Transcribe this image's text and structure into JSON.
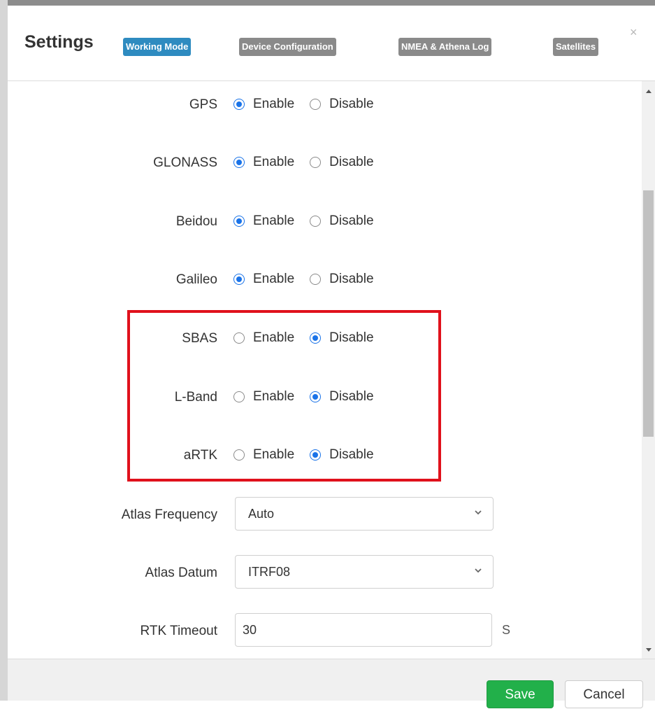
{
  "dialog": {
    "title": "Settings",
    "tabs": [
      {
        "label": "Working Mode",
        "active": true
      },
      {
        "label": "Device Configuration",
        "active": false
      },
      {
        "label": "NMEA & Athena Log",
        "active": false
      },
      {
        "label": "Satellites",
        "active": false
      }
    ],
    "close_glyph": "×"
  },
  "form": {
    "enable_label": "Enable",
    "disable_label": "Disable",
    "constellations": [
      {
        "label": "GPS",
        "value": "Enable"
      },
      {
        "label": "GLONASS",
        "value": "Enable"
      },
      {
        "label": "Beidou",
        "value": "Enable"
      },
      {
        "label": "Galileo",
        "value": "Enable"
      },
      {
        "label": "SBAS",
        "value": "Disable"
      },
      {
        "label": "L-Band",
        "value": "Disable"
      },
      {
        "label": "aRTK",
        "value": "Disable"
      }
    ],
    "atlas_frequency": {
      "label": "Atlas Frequency",
      "value": "Auto"
    },
    "atlas_datum": {
      "label": "Atlas Datum",
      "value": "ITRF08"
    },
    "rtk_timeout": {
      "label": "RTK Timeout",
      "value": "30",
      "unit": "S"
    }
  },
  "footer": {
    "save_label": "Save",
    "cancel_label": "Cancel"
  },
  "colors": {
    "tab_active": "#2e8bc0",
    "tab_inactive": "#8a8a8a",
    "radio_checked": "#1a73e8",
    "highlight_box": "#e0111c",
    "save_button": "#22b04a"
  },
  "icons": {
    "close": "close-icon",
    "select_chevron": "chevron-down-icon"
  }
}
